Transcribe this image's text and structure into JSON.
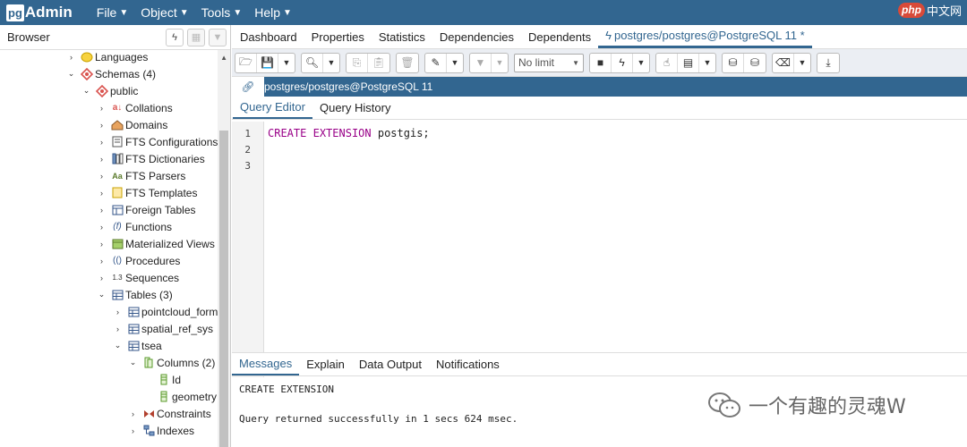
{
  "app": {
    "logo_pg": "pg",
    "logo_admin": "Admin"
  },
  "menu": [
    {
      "label": "File"
    },
    {
      "label": "Object"
    },
    {
      "label": "Tools"
    },
    {
      "label": "Help"
    }
  ],
  "watermark_top": {
    "php": "php",
    "cn": "中文网"
  },
  "browser": {
    "title": "Browser",
    "tree": [
      {
        "label": "Languages",
        "icon": "languages-icon",
        "toggle": "›"
      },
      {
        "label": "Schemas (4)",
        "icon": "schemas-icon",
        "toggle": "⌄"
      },
      {
        "label": "public",
        "icon": "schema-icon",
        "toggle": "⌄"
      },
      {
        "label": "Collations",
        "icon": "collations-icon",
        "toggle": "›"
      },
      {
        "label": "Domains",
        "icon": "domains-icon",
        "toggle": "›"
      },
      {
        "label": "FTS Configurations",
        "icon": "fts-configurations-icon",
        "toggle": "›"
      },
      {
        "label": "FTS Dictionaries",
        "icon": "fts-dictionaries-icon",
        "toggle": "›"
      },
      {
        "label": "FTS Parsers",
        "icon": "fts-parsers-icon",
        "toggle": "›"
      },
      {
        "label": "FTS Templates",
        "icon": "fts-templates-icon",
        "toggle": "›"
      },
      {
        "label": "Foreign Tables",
        "icon": "foreign-tables-icon",
        "toggle": "›"
      },
      {
        "label": "Functions",
        "icon": "functions-icon",
        "toggle": "›"
      },
      {
        "label": "Materialized Views",
        "icon": "materialized-views-icon",
        "toggle": "›"
      },
      {
        "label": "Procedures",
        "icon": "procedures-icon",
        "toggle": "›"
      },
      {
        "label": "Sequences",
        "icon": "sequences-icon",
        "toggle": "›"
      },
      {
        "label": "Tables (3)",
        "icon": "tables-icon",
        "toggle": "⌄"
      },
      {
        "label": "pointcloud_forma",
        "icon": "table-icon",
        "toggle": "›"
      },
      {
        "label": "spatial_ref_sys",
        "icon": "table-icon",
        "toggle": "›"
      },
      {
        "label": "tsea",
        "icon": "table-icon",
        "toggle": "⌄"
      },
      {
        "label": "Columns (2)",
        "icon": "columns-icon",
        "toggle": "⌄"
      },
      {
        "label": "Id",
        "icon": "column-icon",
        "toggle": ""
      },
      {
        "label": "geometry",
        "icon": "column-icon",
        "toggle": ""
      },
      {
        "label": "Constraints",
        "icon": "constraints-icon",
        "toggle": "›"
      },
      {
        "label": "Indexes",
        "icon": "indexes-icon",
        "toggle": "›"
      }
    ]
  },
  "tabs": [
    {
      "label": "Dashboard"
    },
    {
      "label": "Properties"
    },
    {
      "label": "Statistics"
    },
    {
      "label": "Dependencies"
    },
    {
      "label": "Dependents"
    },
    {
      "label": "postgres/postgres@PostgreSQL 11 *"
    }
  ],
  "toolbar": {
    "limit_value": "No limit"
  },
  "connection": {
    "label": "postgres/postgres@PostgreSQL 11"
  },
  "query_tabs": [
    {
      "label": "Query Editor"
    },
    {
      "label": "Query History"
    }
  ],
  "editor": {
    "line_numbers": [
      "1",
      "2",
      "3"
    ],
    "kw1": "CREATE",
    "kw2": "EXTENSION",
    "rest": " postgis;"
  },
  "message_tabs": [
    {
      "label": "Messages"
    },
    {
      "label": "Explain"
    },
    {
      "label": "Data Output"
    },
    {
      "label": "Notifications"
    }
  ],
  "messages": {
    "line1": "CREATE EXTENSION",
    "line2": "Query returned successfully in 1 secs 624 msec."
  },
  "watermark_bottom": {
    "text": "一个有趣的灵魂W"
  },
  "colors": {
    "navbar": "#326690",
    "accent": "#326690",
    "keyword": "#990088"
  }
}
